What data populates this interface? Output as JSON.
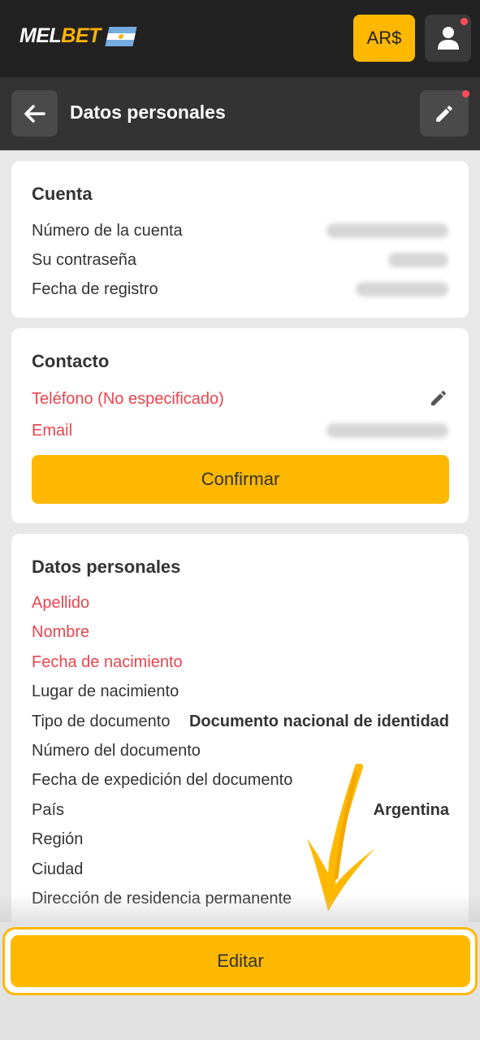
{
  "header": {
    "logo_part1": "MEL",
    "logo_part2": "BET",
    "flag_icon": "argentina-flag-icon",
    "currency": "AR$",
    "user_icon": "user-icon"
  },
  "subheader": {
    "back_icon": "arrow-left-icon",
    "title": "Datos personales",
    "edit_icon": "pencil-icon"
  },
  "cuenta": {
    "title": "Cuenta",
    "rows": [
      {
        "label": "Número de la cuenta",
        "value_hidden": true
      },
      {
        "label": "Su contraseña",
        "value_hidden": true
      },
      {
        "label": "Fecha de registro",
        "value_hidden": true
      }
    ]
  },
  "contacto": {
    "title": "Contacto",
    "phone_label": "Teléfono (No especificado)",
    "email_label": "Email",
    "confirm_label": "Confirmar"
  },
  "personales": {
    "title": "Datos personales",
    "rows": [
      {
        "label": "Apellido",
        "value": "",
        "required": true
      },
      {
        "label": "Nombre",
        "value": "",
        "required": true
      },
      {
        "label": "Fecha de nacimiento",
        "value": "",
        "required": true
      },
      {
        "label": "Lugar de nacimiento",
        "value": ""
      },
      {
        "label": "Tipo de documento",
        "value": "Documento nacional de identidad"
      },
      {
        "label": "Número del documento",
        "value": ""
      },
      {
        "label": "Fecha de expedición del documento",
        "value": ""
      },
      {
        "label": "País",
        "value": "Argentina"
      },
      {
        "label": "Región",
        "value": ""
      },
      {
        "label": "Ciudad",
        "value": ""
      },
      {
        "label": "Dirección de residencia permanente",
        "value": ""
      }
    ]
  },
  "footer": {
    "editar_label": "Editar"
  },
  "colors": {
    "accent": "#ffb800",
    "required": "#e8454e",
    "header_bg": "#222222"
  }
}
